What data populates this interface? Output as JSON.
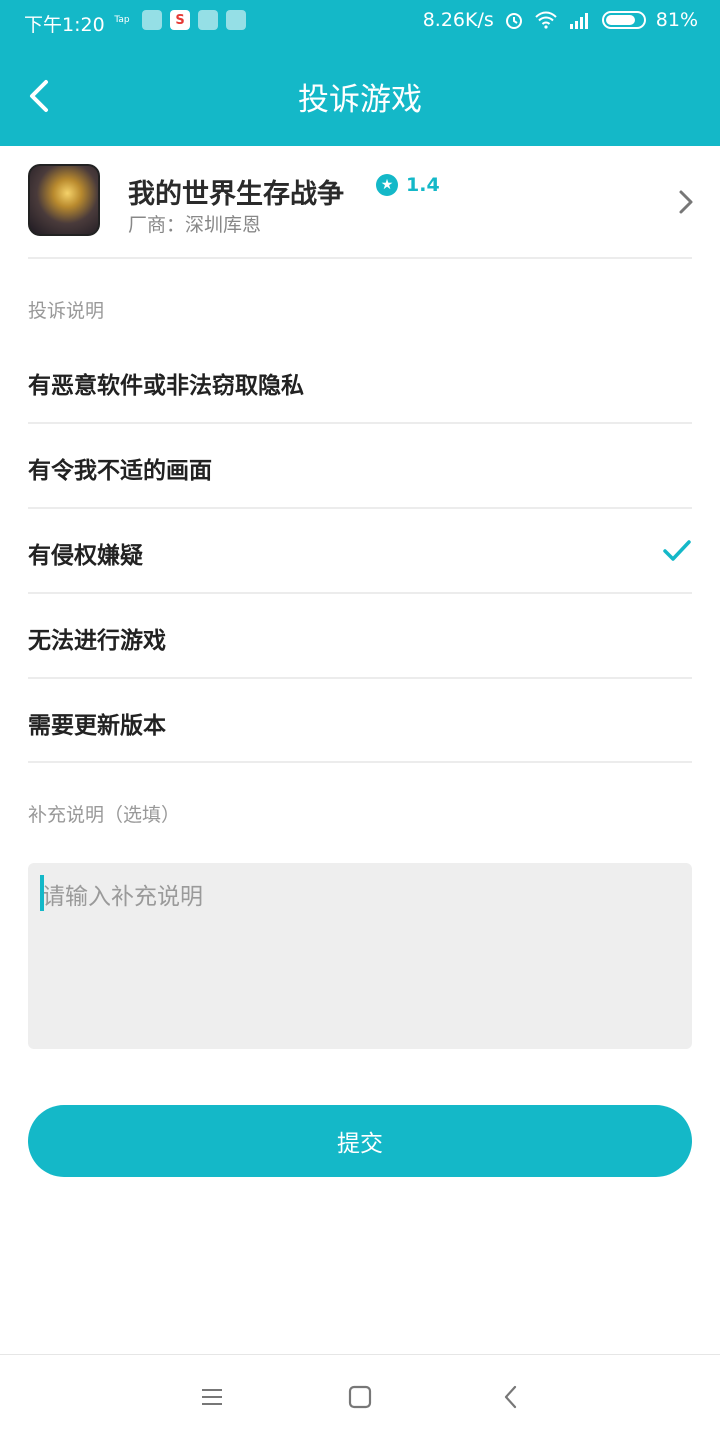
{
  "status_bar": {
    "time": "下午1:20",
    "mini_icons": [
      "Tap",
      "",
      "S",
      "",
      ""
    ],
    "speed": "8.26K/s",
    "battery": "81%",
    "battery_level": 0.81
  },
  "header": {
    "title": "投诉游戏",
    "accent_color": "#14b8c8"
  },
  "game": {
    "name": "我的世界生存战争",
    "rating": "1.4",
    "vendor": "厂商：深圳库恩"
  },
  "complaint": {
    "section_label": "投诉说明",
    "options": [
      {
        "label": "有恶意软件或非法窃取隐私",
        "selected": false
      },
      {
        "label": "有令我不适的画面",
        "selected": false
      },
      {
        "label": "有侵权嫌疑",
        "selected": true
      },
      {
        "label": "无法进行游戏",
        "selected": false
      },
      {
        "label": "需要更新版本",
        "selected": false
      }
    ]
  },
  "supplement": {
    "section_label": "补充说明（选填）",
    "placeholder": "请输入补充说明",
    "value": ""
  },
  "submit_label": "提交",
  "icons": {
    "back": "back-arrow-icon",
    "chevron": "chevron-right-icon",
    "check": "check-icon",
    "star": "star-icon",
    "nav_menu": "menu-icon",
    "nav_home": "home-square-icon",
    "nav_back": "nav-back-icon"
  }
}
